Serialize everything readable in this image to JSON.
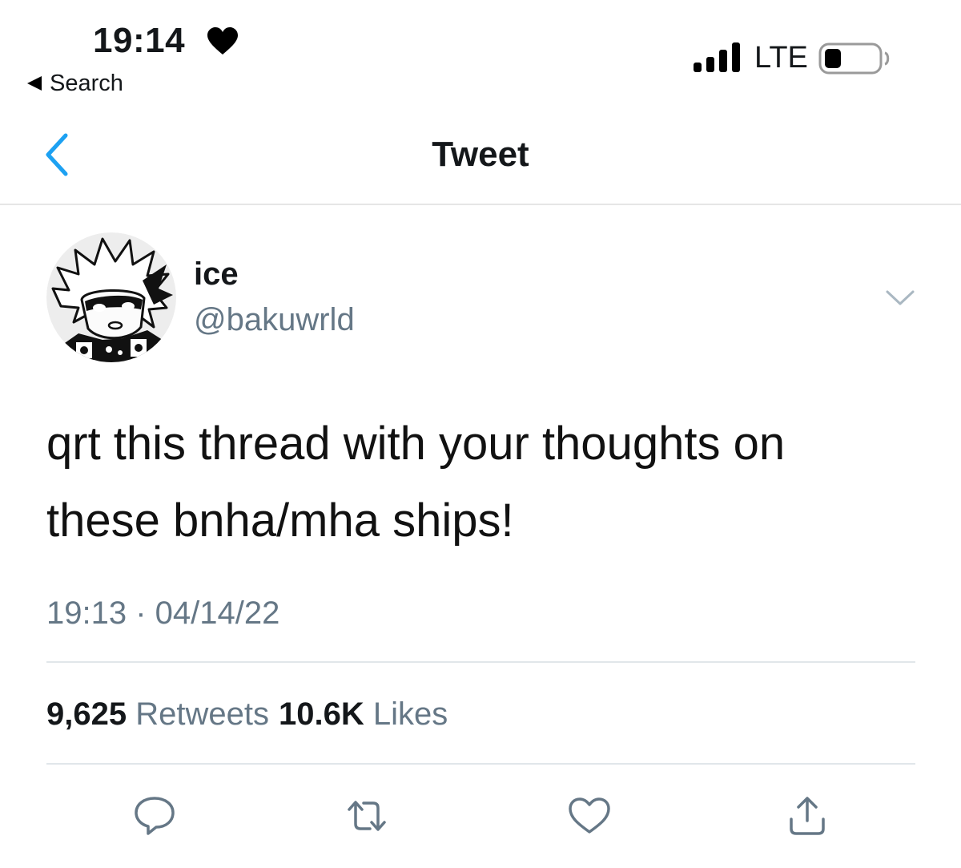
{
  "status_bar": {
    "time": "19:14",
    "back_label": "Search",
    "network": "LTE"
  },
  "nav": {
    "title": "Tweet"
  },
  "tweet": {
    "author": {
      "display_name": "ice",
      "handle": "@bakuwrld"
    },
    "text_line1": "qrt this thread with your thoughts on",
    "text_line2": "these bnha/mha ships!",
    "timestamp": "19:13 · 04/14/22",
    "stats": {
      "retweets_count": "9,625",
      "retweets_label": "Retweets",
      "likes_count": "10.6K",
      "likes_label": "Likes"
    }
  },
  "colors": {
    "accent": "#1da1f2",
    "secondary_text": "#657786",
    "icon_gray": "#657786",
    "divider": "#e1e6ea"
  }
}
